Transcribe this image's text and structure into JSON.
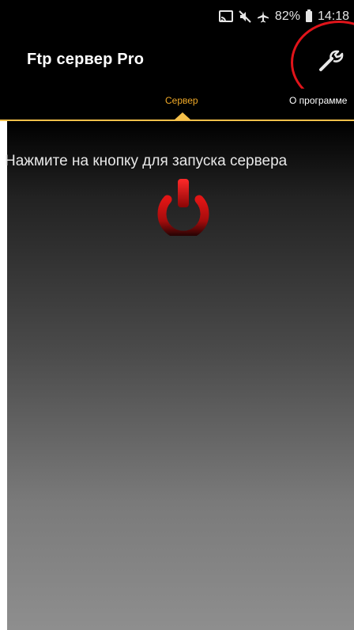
{
  "status_bar": {
    "battery": "82%",
    "time": "14:18"
  },
  "app_bar": {
    "title": "Ftp сервер Pro"
  },
  "tabs": [
    {
      "label": "Сервер"
    },
    {
      "label": "О программе"
    }
  ],
  "content": {
    "hint": "Нажмите на кнопку для запуска сервера"
  },
  "colors": {
    "accent": "#f0a927",
    "indicator": "#f5c04a",
    "power_red": "#cc1010",
    "highlight_circle": "#e0141a"
  }
}
